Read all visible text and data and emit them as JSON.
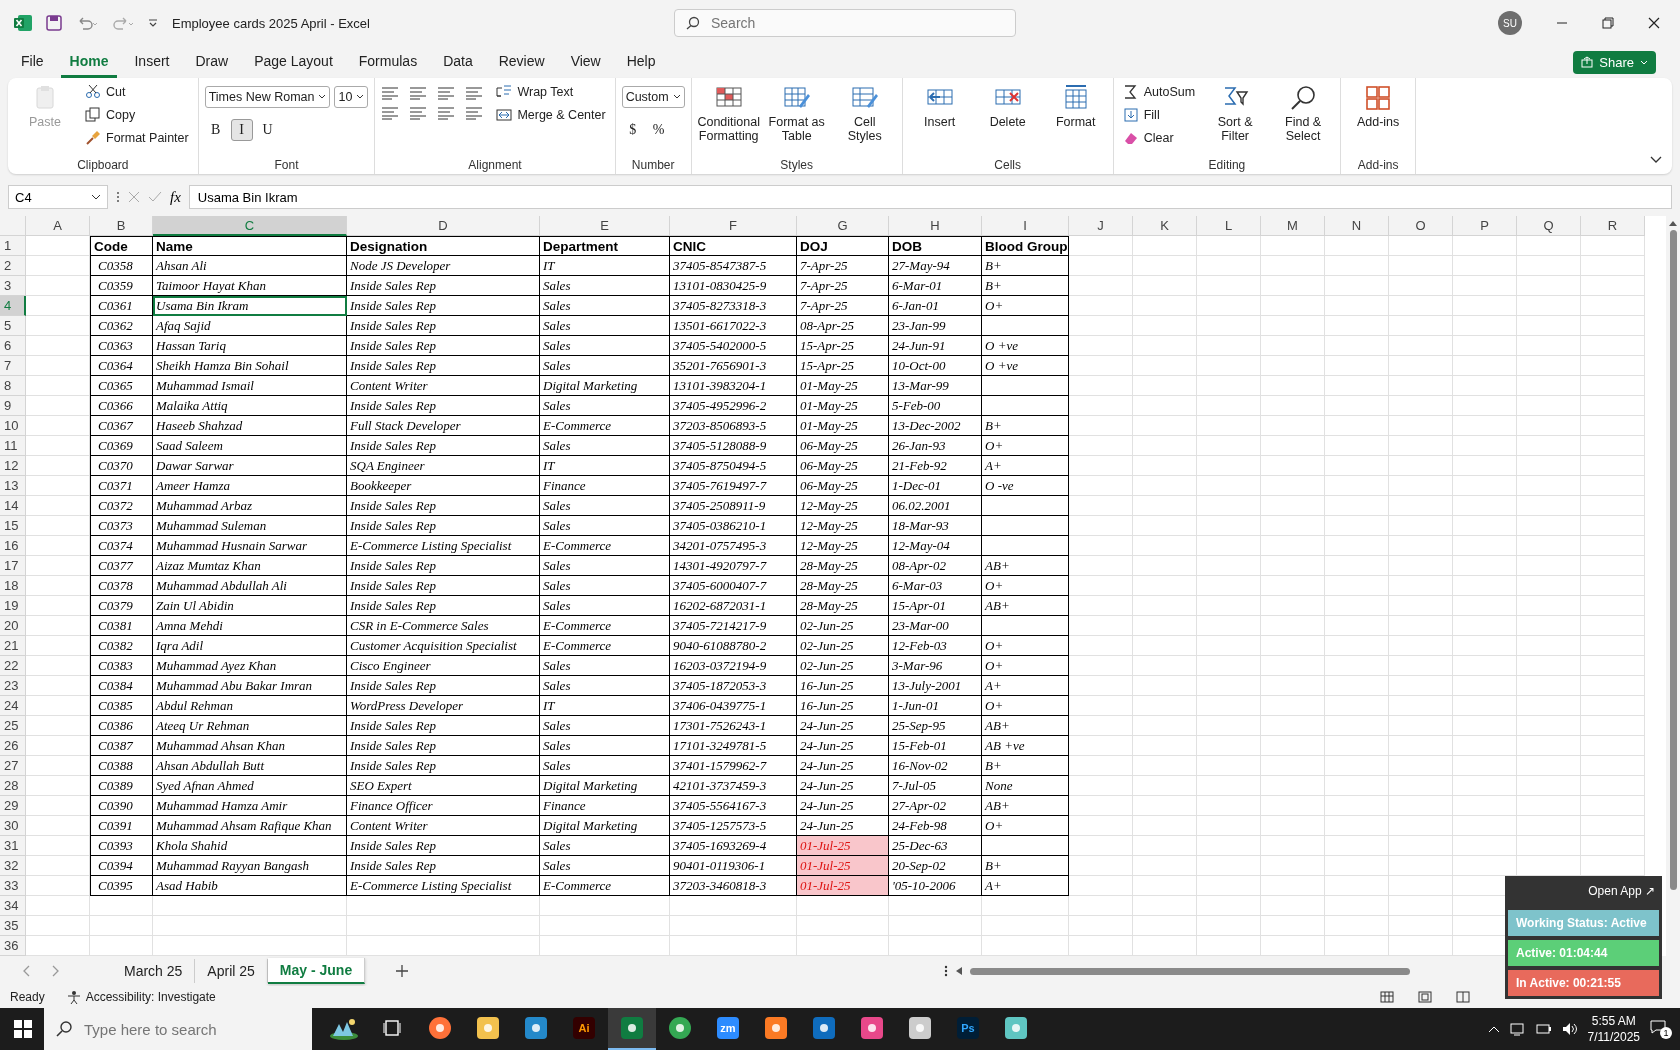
{
  "window": {
    "title": "Employee cards 2025 April  -  Excel",
    "search_placeholder": "Search",
    "avatar": "SU"
  },
  "menu": {
    "tabs": [
      {
        "label": "File",
        "selected": false
      },
      {
        "label": "Home",
        "selected": true
      },
      {
        "label": "Insert",
        "selected": false
      },
      {
        "label": "Draw",
        "selected": false
      },
      {
        "label": "Page Layout",
        "selected": false
      },
      {
        "label": "Formulas",
        "selected": false
      },
      {
        "label": "Data",
        "selected": false
      },
      {
        "label": "Review",
        "selected": false
      },
      {
        "label": "View",
        "selected": false
      },
      {
        "label": "Help",
        "selected": false
      }
    ],
    "share": "Share"
  },
  "ribbon": {
    "groups": [
      {
        "label": "Clipboard",
        "columns": [
          [
            {
              "kind": "large",
              "label": "Paste",
              "disabled": true
            }
          ],
          [
            {
              "kind": "small",
              "label": "Cut"
            },
            {
              "kind": "small",
              "label": "Copy"
            },
            {
              "kind": "small",
              "label": "Format Painter"
            }
          ]
        ]
      },
      {
        "label": "Font",
        "columns": [
          [
            {
              "kind": "strip",
              "items": [
                {
                  "kind": "combo",
                  "value": "Times New Roman"
                },
                {
                  "kind": "combo",
                  "value": "10"
                }
              ]
            },
            {
              "kind": "strip",
              "items": [
                {
                  "kind": "toggle",
                  "label": "B",
                  "selected": false
                },
                {
                  "kind": "toggle",
                  "label": "I",
                  "selected": true
                },
                {
                  "kind": "toggle",
                  "label": "U",
                  "selected": false
                }
              ]
            }
          ]
        ]
      },
      {
        "label": "Alignment",
        "columns": [
          [
            {
              "kind": "aligns"
            }
          ],
          [
            {
              "kind": "small",
              "label": "Wrap Text"
            },
            {
              "kind": "small",
              "label": "Merge & Center"
            }
          ]
        ]
      },
      {
        "label": "Number",
        "columns": [
          [
            {
              "kind": "strip",
              "items": [
                {
                  "kind": "combo",
                  "value": "Custom"
                }
              ]
            },
            {
              "kind": "strip",
              "items": [
                {
                  "kind": "toggle",
                  "label": "$",
                  "selected": false
                },
                {
                  "kind": "toggle",
                  "label": "%",
                  "selected": false
                }
              ]
            }
          ]
        ]
      },
      {
        "label": "Styles",
        "columns": [
          [
            {
              "kind": "large",
              "label": "Conditional Formatting",
              "disabled": false
            }
          ],
          [
            {
              "kind": "large",
              "label": "Format as Table",
              "disabled": false
            }
          ],
          [
            {
              "kind": "large",
              "label": "Cell Styles",
              "disabled": false
            }
          ]
        ]
      },
      {
        "label": "Cells",
        "columns": [
          [
            {
              "kind": "large",
              "label": "Insert",
              "disabled": false
            }
          ],
          [
            {
              "kind": "large",
              "label": "Delete",
              "disabled": false
            }
          ],
          [
            {
              "kind": "large",
              "label": "Format",
              "disabled": false
            }
          ]
        ]
      },
      {
        "label": "Editing",
        "columns": [
          [
            {
              "kind": "small",
              "label": "AutoSum"
            },
            {
              "kind": "small",
              "label": "Fill"
            },
            {
              "kind": "small",
              "label": "Clear"
            }
          ],
          [
            {
              "kind": "large",
              "label": "Sort & Filter",
              "disabled": false
            }
          ],
          [
            {
              "kind": "large",
              "label": "Find & Select",
              "disabled": false
            }
          ]
        ]
      },
      {
        "label": "Add-ins",
        "columns": [
          [
            {
              "kind": "large",
              "label": "Add-ins",
              "disabled": false
            }
          ]
        ]
      }
    ]
  },
  "formula_bar": {
    "name_box": "C4",
    "fx": "fx",
    "value": "Usama Bin Ikram"
  },
  "sheet": {
    "column_letters": [
      "A",
      "B",
      "C",
      "D",
      "E",
      "F",
      "G",
      "H",
      "I",
      "J",
      "K",
      "L",
      "M",
      "N",
      "O",
      "P",
      "Q",
      "R"
    ],
    "row_numbers": [
      "1",
      "2",
      "3",
      "4",
      "5",
      "6",
      "7",
      "8",
      "9",
      "10",
      "11",
      "12",
      "13",
      "14",
      "15",
      "16",
      "17",
      "18",
      "19",
      "20",
      "21",
      "22",
      "23",
      "24",
      "25",
      "26",
      "27",
      "28",
      "29",
      "30",
      "31",
      "32",
      "33",
      "34",
      "35",
      "36"
    ],
    "table": {
      "columns": [
        "Code",
        "Name",
        "Designation",
        "Department",
        "CNIC",
        "DOJ",
        "DOB",
        "Blood Group"
      ],
      "rows": [
        {
          "code": "C0358",
          "name": "Ahsan Ali",
          "designation": "Node JS Developer",
          "department": "IT",
          "cnic": "37405-8547387-5",
          "doj": "7-Apr-25",
          "dob": "27-May-94",
          "blood_group": "B+",
          "selected": false,
          "doj_flagged": false
        },
        {
          "code": "C0359",
          "name": "Taimoor Hayat Khan",
          "designation": "Inside Sales Rep",
          "department": "Sales",
          "cnic": "13101-0830425-9",
          "doj": "7-Apr-25",
          "dob": "6-Mar-01",
          "blood_group": "B+",
          "selected": false,
          "doj_flagged": false
        },
        {
          "code": "C0361",
          "name": "Usama Bin Ikram",
          "designation": "Inside Sales Rep",
          "department": "Sales",
          "cnic": "37405-8273318-3",
          "doj": "7-Apr-25",
          "dob": "6-Jan-01",
          "blood_group": "O+",
          "selected": true,
          "doj_flagged": false
        },
        {
          "code": "C0362",
          "name": "Afaq Sajid",
          "designation": "Inside Sales Rep",
          "department": "Sales",
          "cnic": "13501-6617022-3",
          "doj": "08-Apr-25",
          "dob": "23-Jan-99",
          "selected": false,
          "doj_flagged": false
        },
        {
          "code": "C0363",
          "name": "Hassan Tariq",
          "designation": "Inside Sales Rep",
          "department": "Sales",
          "cnic": "37405-5402000-5",
          "doj": "15-Apr-25",
          "dob": "24-Jun-91",
          "blood_group": "O +ve",
          "selected": false,
          "doj_flagged": false
        },
        {
          "code": "C0364",
          "name": "Sheikh Hamza Bin Sohail",
          "designation": "Inside Sales Rep",
          "department": "Sales",
          "cnic": "35201-7656901-3",
          "doj": "15-Apr-25",
          "dob": "10-Oct-00",
          "blood_group": "O +ve",
          "selected": false,
          "doj_flagged": false
        },
        {
          "code": "C0365",
          "name": "Muhammad Ismail",
          "designation": "Content Writer",
          "department": "Digital Marketing",
          "cnic": "13101-3983204-1",
          "doj": "01-May-25",
          "dob": "13-Mar-99",
          "selected": false,
          "doj_flagged": false
        },
        {
          "code": "C0366",
          "name": "Malaika Attiq",
          "designation": "Inside Sales Rep",
          "department": "Sales",
          "cnic": "37405-4952996-2",
          "doj": "01-May-25",
          "dob": "5-Feb-00",
          "selected": false,
          "doj_flagged": false
        },
        {
          "code": "C0367",
          "name": "Haseeb Shahzad",
          "designation": "Full Stack Developer",
          "department": "E-Commerce",
          "cnic": "37203-8506893-5",
          "doj": "01-May-25",
          "dob": "13-Dec-2002",
          "blood_group": "B+",
          "selected": false,
          "doj_flagged": false
        },
        {
          "code": "C0369",
          "name": "Saad Saleem",
          "designation": "Inside Sales Rep",
          "department": "Sales",
          "cnic": "37405-5128088-9",
          "doj": "06-May-25",
          "dob": "26-Jan-93",
          "blood_group": "O+",
          "selected": false,
          "doj_flagged": false
        },
        {
          "code": "C0370",
          "name": "Dawar Sarwar",
          "designation": "SQA Engineer",
          "department": "IT",
          "cnic": "37405-8750494-5",
          "doj": "06-May-25",
          "dob": "21-Feb-92",
          "blood_group": "A+",
          "selected": false,
          "doj_flagged": false
        },
        {
          "code": "C0371",
          "name": "Ameer Hamza",
          "designation": "Bookkeeper",
          "department": "Finance",
          "cnic": "37405-7619497-7",
          "doj": "06-May-25",
          "dob": "1-Dec-01",
          "blood_group": "O -ve",
          "selected": false,
          "doj_flagged": false
        },
        {
          "code": "C0372",
          "name": "Muhammad Arbaz",
          "designation": "Inside Sales Rep",
          "department": "Sales",
          "cnic": "37405-2508911-9",
          "doj": "12-May-25",
          "dob": "06.02.2001",
          "selected": false,
          "doj_flagged": false
        },
        {
          "code": "C0373",
          "name": "Muhammad Suleman",
          "designation": "Inside Sales Rep",
          "department": "Sales",
          "cnic": "37405-0386210-1",
          "doj": "12-May-25",
          "dob": "18-Mar-93",
          "selected": false,
          "doj_flagged": false
        },
        {
          "code": "C0374",
          "name": "Muhammad Husnain Sarwar",
          "designation": "E-Commerce Listing Specialist",
          "department": "E-Commerce",
          "cnic": "34201-0757495-3",
          "doj": "12-May-25",
          "dob": "12-May-04",
          "selected": false,
          "doj_flagged": false
        },
        {
          "code": "C0377",
          "name": "Aizaz Mumtaz Khan",
          "designation": "Inside Sales Rep",
          "department": "Sales",
          "cnic": "14301-4920797-7",
          "doj": "28-May-25",
          "dob": "08-Apr-02",
          "blood_group": "AB+",
          "selected": false,
          "doj_flagged": false
        },
        {
          "code": "C0378",
          "name": "Muhammad Abdullah Ali",
          "designation": "Inside Sales Rep",
          "department": "Sales",
          "cnic": "37405-6000407-7",
          "doj": "28-May-25",
          "dob": "6-Mar-03",
          "blood_group": "O+",
          "selected": false,
          "doj_flagged": false
        },
        {
          "code": "C0379",
          "name": "Zain Ul Abidin",
          "designation": "Inside Sales Rep",
          "department": "Sales",
          "cnic": "16202-6872031-1",
          "doj": "28-May-25",
          "dob": "15-Apr-01",
          "blood_group": "AB+",
          "selected": false,
          "doj_flagged": false
        },
        {
          "code": "C0381",
          "name": "Amna Mehdi",
          "designation": "CSR in E-Commerce Sales",
          "department": "E-Commerce",
          "cnic": "37405-7214217-9",
          "doj": "02-Jun-25",
          "dob": "23-Mar-00",
          "selected": false,
          "doj_flagged": false
        },
        {
          "code": "C0382",
          "name": "Iqra Adil",
          "designation": "Customer Acquisition Specialist",
          "department": "E-Commerce",
          "cnic": "9040-61088780-2",
          "doj": "02-Jun-25",
          "dob": "12-Feb-03",
          "blood_group": "O+",
          "selected": false,
          "doj_flagged": false
        },
        {
          "code": "C0383",
          "name": "Muhammad Ayez Khan",
          "designation": "Cisco Engineer",
          "department": "Sales",
          "cnic": "16203-0372194-9",
          "doj": "02-Jun-25",
          "dob": "3-Mar-96",
          "blood_group": "O+",
          "selected": false,
          "doj_flagged": false
        },
        {
          "code": "C0384",
          "name": "Muhammad Abu Bakar Imran",
          "designation": "Inside Sales Rep",
          "department": "Sales",
          "cnic": "37405-1872053-3",
          "doj": "16-Jun-25",
          "dob": "13-July-2001",
          "blood_group": "A+",
          "selected": false,
          "doj_flagged": false
        },
        {
          "code": "C0385",
          "name": "Abdul Rehman",
          "designation": "WordPress Developer",
          "department": "IT",
          "cnic": "37406-0439775-1",
          "doj": "16-Jun-25",
          "dob": "1-Jun-01",
          "blood_group": "O+",
          "selected": false,
          "doj_flagged": false
        },
        {
          "code": "C0386",
          "name": "Ateeq Ur Rehman",
          "designation": "Inside Sales Rep",
          "department": "Sales",
          "cnic": "17301-7526243-1",
          "doj": "24-Jun-25",
          "dob": "25-Sep-95",
          "blood_group": "AB+",
          "selected": false,
          "doj_flagged": false
        },
        {
          "code": "C0387",
          "name": "Muhammad Ahsan Khan",
          "designation": "Inside Sales Rep",
          "department": "Sales",
          "cnic": "17101-3249781-5",
          "doj": "24-Jun-25",
          "dob": "15-Feb-01",
          "blood_group": "AB +ve",
          "selected": false,
          "doj_flagged": false
        },
        {
          "code": "C0388",
          "name": "Ahsan Abdullah Butt",
          "designation": "Inside Sales Rep",
          "department": "Sales",
          "cnic": "37401-1579962-7",
          "doj": "24-Jun-25",
          "dob": "16-Nov-02",
          "blood_group": "B+",
          "selected": false,
          "doj_flagged": false
        },
        {
          "code": "C0389",
          "name": "Syed Afnan Ahmed",
          "designation": "SEO Expert",
          "department": "Digital Marketing",
          "cnic": "42101-3737459-3",
          "doj": "24-Jun-25",
          "dob": "7-Jul-05",
          "blood_group": "None",
          "selected": false,
          "doj_flagged": false
        },
        {
          "code": "C0390",
          "name": "Muhammad Hamza Amir",
          "designation": "Finance Officer",
          "department": "Finance",
          "cnic": "37405-5564167-3",
          "doj": "24-Jun-25",
          "dob": "27-Apr-02",
          "blood_group": "AB+",
          "selected": false,
          "doj_flagged": false
        },
        {
          "code": "C0391",
          "name": "Muhammad Ahsam Rafique Khan",
          "designation": "Content Writer",
          "department": "Digital Marketing",
          "cnic": "37405-1257573-5",
          "doj": "24-Jun-25",
          "dob": "24-Feb-98",
          "blood_group": "O+",
          "selected": false,
          "doj_flagged": false
        },
        {
          "code": "C0393",
          "name": "Khola Shahid",
          "designation": "Inside Sales Rep",
          "department": "Sales",
          "cnic": "37405-1693269-4",
          "doj": "01-Jul-25",
          "dob": "25-Dec-63",
          "selected": false,
          "doj_flagged": true
        },
        {
          "code": "C0394",
          "name": "Muhammad Rayyan Bangash",
          "designation": "Inside Sales Rep",
          "department": "Sales",
          "cnic": "90401-0119306-1",
          "doj": "01-Jul-25",
          "dob": "20-Sep-02",
          "blood_group": "B+",
          "selected": false,
          "doj_flagged": true
        },
        {
          "code": "C0395",
          "name": "Asad Habib",
          "designation": "E-Commerce Listing Specialist",
          "department": "E-Commerce",
          "cnic": "37203-3460818-3",
          "doj": "01-Jul-25",
          "dob": "'05-10-2006",
          "blood_group": "A+",
          "selected": false,
          "doj_flagged": true
        }
      ]
    }
  },
  "sheet_tabs": [
    {
      "label": "March 25",
      "selected": false
    },
    {
      "label": "April 25",
      "selected": false
    },
    {
      "label": "May - June",
      "selected": true
    }
  ],
  "status_bar": {
    "ready": "Ready",
    "accessibility": "Accessibility: Investigate"
  },
  "tracker": {
    "open_app": "Open App ↗",
    "status": "Working Status: Active",
    "active": "Active: 01:04:44",
    "inactive": "In Active: 00:21:55"
  },
  "taskbar": {
    "search_placeholder": "Type here to search",
    "apps": [
      {
        "kind": "widget",
        "selected": false
      },
      {
        "kind": "taskview",
        "selected": false
      },
      {
        "kind": "firefox",
        "selected": false
      },
      {
        "kind": "folder",
        "selected": false
      },
      {
        "kind": "vscode",
        "selected": false
      },
      {
        "kind": "illustrator",
        "label": "Ai",
        "selected": false
      },
      {
        "kind": "excel",
        "selected": true
      },
      {
        "kind": "chrome",
        "selected": false
      },
      {
        "kind": "zoom",
        "label": "zm",
        "selected": false
      },
      {
        "kind": "xampp",
        "selected": false
      },
      {
        "kind": "outlook",
        "selected": false
      },
      {
        "kind": "cloud",
        "selected": false
      },
      {
        "kind": "pen",
        "selected": false
      },
      {
        "kind": "photoshop",
        "label": "Ps",
        "selected": false
      },
      {
        "kind": "gem",
        "selected": false
      }
    ],
    "time": "5:55 AM",
    "date": "7/11/2025",
    "notifications": "1"
  }
}
